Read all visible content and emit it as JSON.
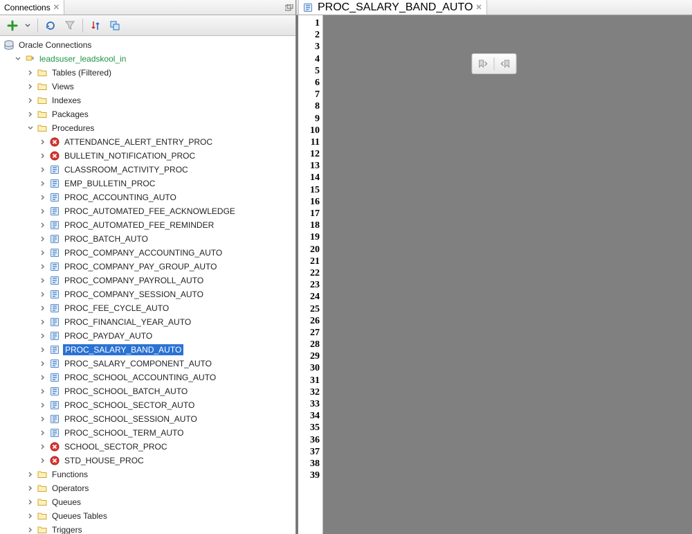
{
  "left": {
    "tab": {
      "label": "Connections"
    },
    "root": {
      "label": "Oracle Connections"
    },
    "connection": {
      "label": "leadsuser_leadskool_in"
    },
    "folders": {
      "tables": "Tables (Filtered)",
      "views": "Views",
      "indexes": "Indexes",
      "packages": "Packages",
      "procedures": "Procedures",
      "functions": "Functions",
      "operators": "Operators",
      "queues": "Queues",
      "queues_tables": "Queues Tables",
      "triggers": "Triggers"
    },
    "procedures": [
      {
        "name": "ATTENDANCE_ALERT_ENTRY_PROC",
        "error": true
      },
      {
        "name": "BULLETIN_NOTIFICATION_PROC",
        "error": true
      },
      {
        "name": "CLASSROOM_ACTIVITY_PROC",
        "error": false
      },
      {
        "name": "EMP_BULLETIN_PROC",
        "error": false
      },
      {
        "name": "PROC_ACCOUNTING_AUTO",
        "error": false
      },
      {
        "name": "PROC_AUTOMATED_FEE_ACKNOWLEDGE",
        "error": false
      },
      {
        "name": "PROC_AUTOMATED_FEE_REMINDER",
        "error": false
      },
      {
        "name": "PROC_BATCH_AUTO",
        "error": false
      },
      {
        "name": "PROC_COMPANY_ACCOUNTING_AUTO",
        "error": false
      },
      {
        "name": "PROC_COMPANY_PAY_GROUP_AUTO",
        "error": false
      },
      {
        "name": "PROC_COMPANY_PAYROLL_AUTO",
        "error": false
      },
      {
        "name": "PROC_COMPANY_SESSION_AUTO",
        "error": false
      },
      {
        "name": "PROC_FEE_CYCLE_AUTO",
        "error": false
      },
      {
        "name": "PROC_FINANCIAL_YEAR_AUTO",
        "error": false
      },
      {
        "name": "PROC_PAYDAY_AUTO",
        "error": false
      },
      {
        "name": "PROC_SALARY_BAND_AUTO",
        "error": false,
        "selected": true
      },
      {
        "name": "PROC_SALARY_COMPONENT_AUTO",
        "error": false
      },
      {
        "name": "PROC_SCHOOL_ACCOUNTING_AUTO",
        "error": false
      },
      {
        "name": "PROC_SCHOOL_BATCH_AUTO",
        "error": false
      },
      {
        "name": "PROC_SCHOOL_SECTOR_AUTO",
        "error": false
      },
      {
        "name": "PROC_SCHOOL_SESSION_AUTO",
        "error": false
      },
      {
        "name": "PROC_SCHOOL_TERM_AUTO",
        "error": false
      },
      {
        "name": "SCHOOL_SECTOR_PROC",
        "error": true
      },
      {
        "name": "STD_HOUSE_PROC",
        "error": true
      }
    ]
  },
  "right": {
    "tab": {
      "label": "PROC_SALARY_BAND_AUTO"
    },
    "line_count": 39
  }
}
